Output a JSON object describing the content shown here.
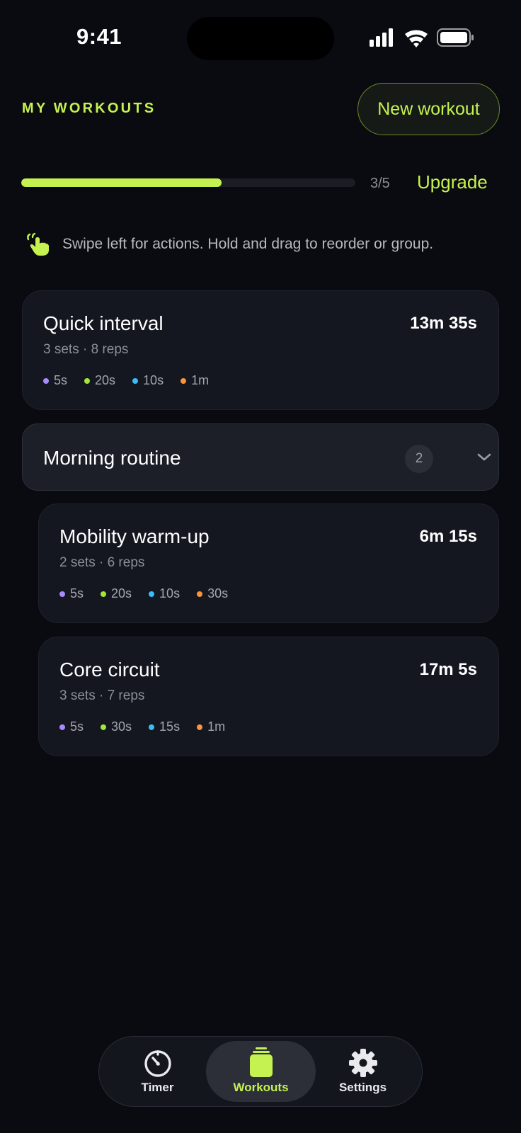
{
  "status_bar": {
    "time": "9:41"
  },
  "header": {
    "title": "MY WORKOUTS",
    "new_workout_label": "New workout"
  },
  "usage": {
    "count_text": "3/5",
    "used": 3,
    "limit": 5,
    "upgrade_label": "Upgrade"
  },
  "hint": {
    "text": "Swipe left for actions. Hold and drag to reorder or group."
  },
  "colors": {
    "accent": "#c5f250",
    "segment_purple": "#a78bfa",
    "segment_green": "#a3e635",
    "segment_blue": "#38bdf8",
    "segment_orange": "#fb923c"
  },
  "workouts": [
    {
      "title": "Quick interval",
      "duration": "13m 35s",
      "meta": "3 sets · 8 reps",
      "segments": [
        {
          "label": "5s",
          "color": "#a78bfa"
        },
        {
          "label": "20s",
          "color": "#a3e635"
        },
        {
          "label": "10s",
          "color": "#38bdf8"
        },
        {
          "label": "1m",
          "color": "#fb923c"
        }
      ]
    }
  ],
  "group": {
    "title": "Morning routine",
    "count": "2",
    "workouts": [
      {
        "title": "Mobility warm-up",
        "duration": "6m 15s",
        "meta": "2 sets · 6 reps",
        "segments": [
          {
            "label": "5s",
            "color": "#a78bfa"
          },
          {
            "label": "20s",
            "color": "#a3e635"
          },
          {
            "label": "10s",
            "color": "#38bdf8"
          },
          {
            "label": "30s",
            "color": "#fb923c"
          }
        ]
      },
      {
        "title": "Core circuit",
        "duration": "17m 5s",
        "meta": "3 sets · 7 reps",
        "segments": [
          {
            "label": "5s",
            "color": "#a78bfa"
          },
          {
            "label": "30s",
            "color": "#a3e635"
          },
          {
            "label": "15s",
            "color": "#38bdf8"
          },
          {
            "label": "1m",
            "color": "#fb923c"
          }
        ]
      }
    ]
  },
  "tabbar": {
    "tabs": [
      {
        "label": "Timer",
        "icon": "stopwatch-icon",
        "active": false
      },
      {
        "label": "Workouts",
        "icon": "workouts-stack-icon",
        "active": true
      },
      {
        "label": "Settings",
        "icon": "gear-icon",
        "active": false
      }
    ]
  }
}
